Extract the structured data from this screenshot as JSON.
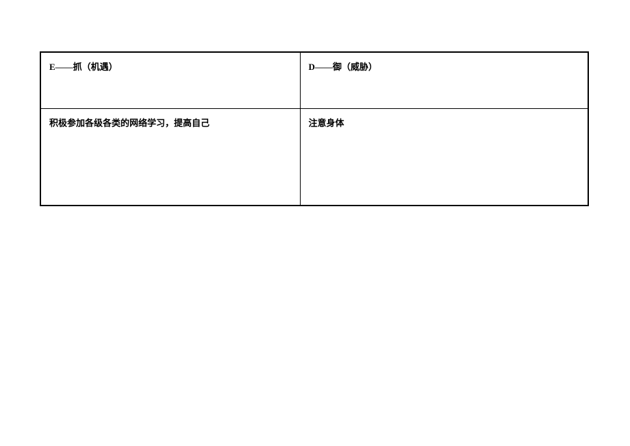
{
  "table": {
    "headers": {
      "left": "E——抓（机遇）",
      "right": "D——御（威胁）"
    },
    "content": {
      "left": "积极参加各级各类的网络学习，提高自己",
      "right": "注意身体"
    }
  }
}
